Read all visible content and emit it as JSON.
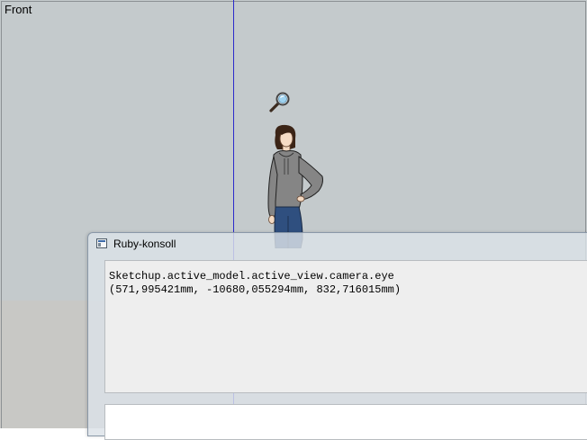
{
  "viewport": {
    "scene_label": "Front"
  },
  "console": {
    "title": "Ruby-konsoll",
    "output_lines": [
      "Sketchup.active_model.active_view.camera.eye",
      "(571,995421mm, -10680,055294mm, 832,716015mm)"
    ],
    "input_value": ""
  },
  "icons": {
    "zoom": "zoom-tool-icon",
    "app": "ruby-console-icon"
  },
  "colors": {
    "sky": "#c4cacc",
    "ground": "#c8c8c5",
    "blue_axis": "#2a2acb"
  }
}
